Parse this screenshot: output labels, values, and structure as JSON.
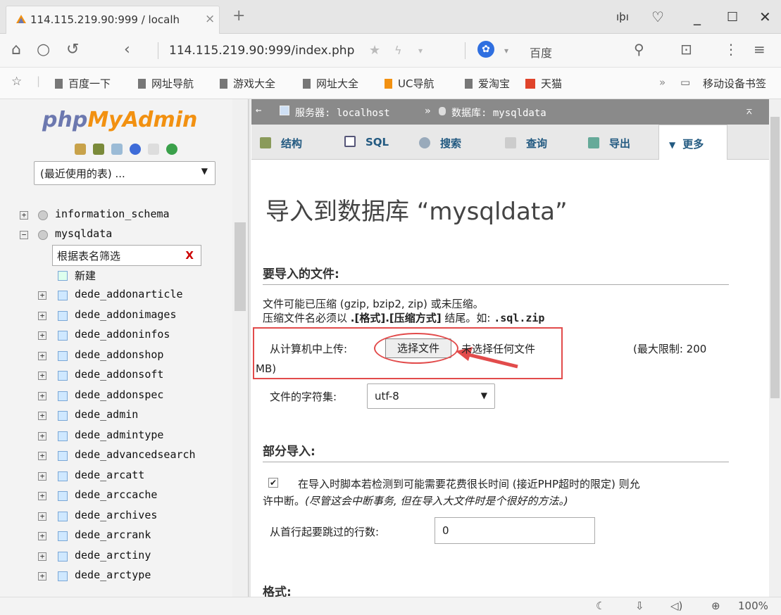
{
  "browser": {
    "tab_title": "114.115.219.90:999 / localh",
    "tab_close": "×",
    "new_tab": "+",
    "address": "114.115.219.90:999/index.php",
    "search_engine": "百度",
    "zoom": "100%"
  },
  "bookmarks": [
    "百度一下",
    "网址导航",
    "游戏大全",
    "网址大全",
    "UC导航",
    "爱淘宝",
    "天猫"
  ],
  "bookmarks_more": "»",
  "mobile_bookmarks": "移动设备书签",
  "sidebar": {
    "logo_a": "php",
    "logo_b": "MyAdmin",
    "recent_tables": "(最近使用的表) ...",
    "dbs": [
      "information_schema",
      "mysqldata"
    ],
    "filter_placeholder": "根据表名筛选",
    "filter_clear": "X",
    "new_label": "新建",
    "tables": [
      "dede_addonarticle",
      "dede_addonimages",
      "dede_addoninfos",
      "dede_addonshop",
      "dede_addonsoft",
      "dede_addonspec",
      "dede_admin",
      "dede_admintype",
      "dede_advancedsearch",
      "dede_arcatt",
      "dede_arccache",
      "dede_archives",
      "dede_arcrank",
      "dede_arctiny",
      "dede_arctype"
    ]
  },
  "breadcrumb": {
    "server": "服务器: localhost",
    "sep": "»",
    "database": "数据库: mysqldata"
  },
  "tabs": [
    "结构",
    "SQL",
    "搜索",
    "查询",
    "导出",
    "更多"
  ],
  "main": {
    "title": "导入到数据库 “mysqldata”",
    "file_section": "要导入的文件:",
    "compress_note": "文件可能已压缩 (gzip, bzip2, zip) 或未压缩。",
    "compress_note2_a": "压缩文件名必须以 ",
    "compress_note2_b": ".[格式].[压缩方式]",
    "compress_note2_c": " 结尾。如: ",
    "compress_note2_d": ".sql.zip",
    "upload_label": "从计算机中上传:",
    "choose_button": "选择文件",
    "no_file": "未选择任何文件",
    "max_limit": "(最大限制: 200",
    "max_limit_unit": "MB)",
    "charset_label": "文件的字符集:",
    "charset_value": "utf-8",
    "partial_section": "部分导入:",
    "partial_text": "在导入时脚本若检测到可能需要花费很长时间 (接近PHP超时的限定) 则允",
    "partial_text2": "许中断。",
    "partial_note": "(尽管这会中断事务, 但在导入大文件时是个很好的方法。)",
    "skip_label": "从首行起要跳过的行数:",
    "skip_value": "0",
    "format_section": "格式:"
  }
}
